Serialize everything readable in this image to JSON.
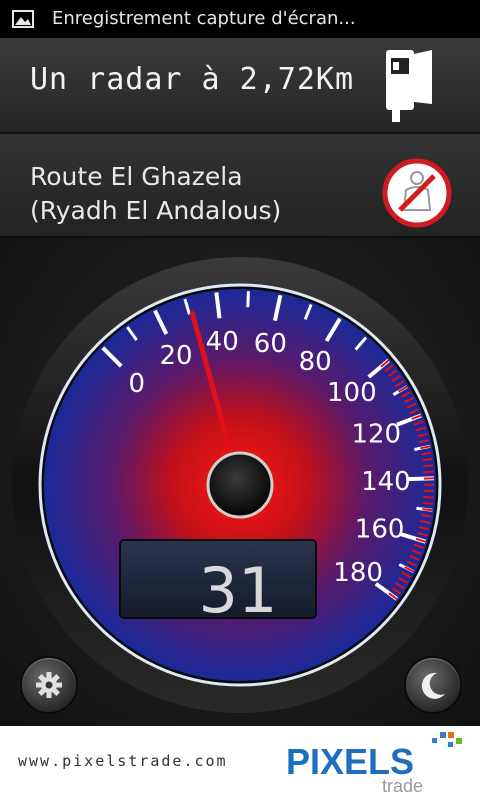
{
  "status_bar": {
    "notification_text": "Enregistrement capture d'écran...",
    "icon": "image-icon"
  },
  "radar": {
    "distance_text": "Un radar à 2,72Km",
    "icon": "speed-camera-icon"
  },
  "route": {
    "line1": "Route El Ghazela",
    "line2": "(Ryadh El Andalous)",
    "icon": "seatbelt-warning-icon"
  },
  "speedometer": {
    "ticks": [
      "0",
      "20",
      "40",
      "60",
      "80",
      "100",
      "120",
      "140",
      "160",
      "180"
    ],
    "min": 0,
    "max": 180,
    "needle_value": 31,
    "digital_speed": "31",
    "accent_color": "#e0101a",
    "dial_color": "#1c2a8f",
    "redline_start": 100
  },
  "buttons": {
    "settings_icon": "gear-icon",
    "night_mode_icon": "moon-icon"
  },
  "footer": {
    "url": "www.pixelstrade.com",
    "logo_text": "PIXELS",
    "logo_subtext": "trade"
  }
}
